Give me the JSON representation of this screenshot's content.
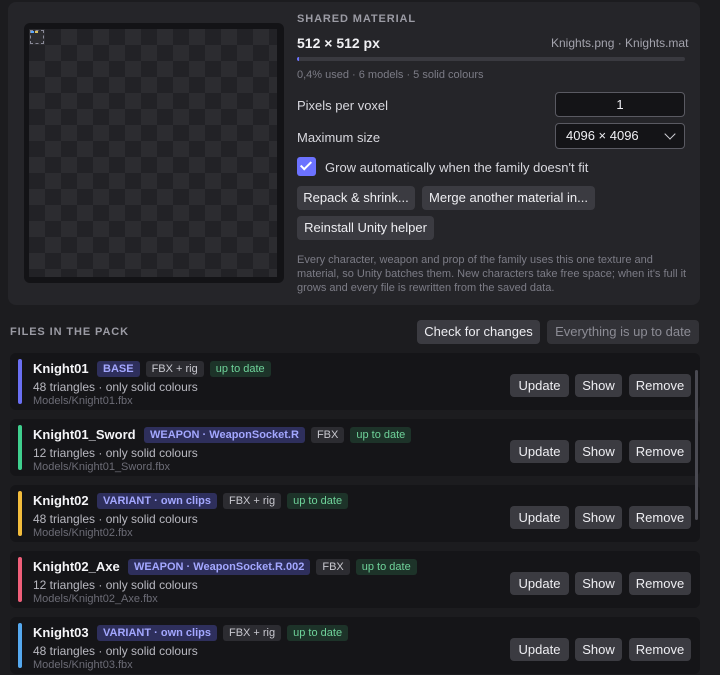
{
  "material": {
    "section_label": "SHARED MATERIAL",
    "size": "512 × 512 px",
    "files": "Knights.png · Knights.mat",
    "usage_fraction": 0.004,
    "stats": "0,4% used · 6 models · 5 solid colours",
    "ppv_label": "Pixels per voxel",
    "ppv_value": "1",
    "max_label": "Maximum size",
    "max_value": "4096 × 4096",
    "grow_label": "Grow automatically when the family doesn't fit",
    "grow_checked": true,
    "repack_label": "Repack & shrink...",
    "merge_label": "Merge another material in...",
    "reinstall_label": "Reinstall Unity helper",
    "description": "Every character, weapon and prop of the family uses this one texture and material, so Unity batches them. New characters take free space; when it's full it grows and every file is rewritten from the saved data."
  },
  "files": {
    "section_label": "FILES IN THE PACK",
    "check_label": "Check for changes",
    "status_label": "Everything is up to date",
    "action_update": "Update",
    "action_show": "Show",
    "action_remove": "Remove",
    "items": [
      {
        "name": "Knight01",
        "role": "BASE",
        "kind": "FBX + rig",
        "status": "up to date",
        "info": "48 triangles · only solid colours",
        "path": "Models/Knight01.fbx",
        "color": "#6a6ff2"
      },
      {
        "name": "Knight01_Sword",
        "role": "WEAPON · WeaponSocket.R",
        "kind": "FBX",
        "status": "up to date",
        "info": "12 triangles · only solid colours",
        "path": "Models/Knight01_Sword.fbx",
        "color": "#3fcf8e"
      },
      {
        "name": "Knight02",
        "role": "VARIANT · own clips",
        "kind": "FBX + rig",
        "status": "up to date",
        "info": "48 triangles · only solid colours",
        "path": "Models/Knight02.fbx",
        "color": "#f2bc3c"
      },
      {
        "name": "Knight02_Axe",
        "role": "WEAPON · WeaponSocket.R.002",
        "kind": "FBX",
        "status": "up to date",
        "info": "12 triangles · only solid colours",
        "path": "Models/Knight02_Axe.fbx",
        "color": "#ef5f7a"
      },
      {
        "name": "Knight03",
        "role": "VARIANT · own clips",
        "kind": "FBX + rig",
        "status": "up to date",
        "info": "48 triangles · only solid colours",
        "path": "Models/Knight03.fbx",
        "color": "#55a8ee"
      }
    ]
  }
}
